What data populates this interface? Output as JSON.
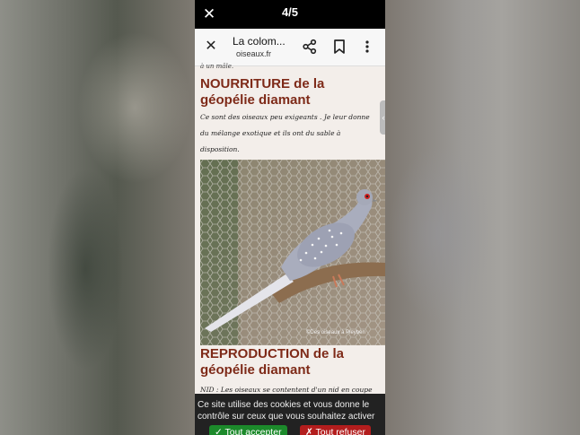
{
  "viewer": {
    "close_glyph": "✕",
    "counter": "4/5"
  },
  "browser": {
    "title": "La colom...",
    "domain": "oiseaux.fr",
    "close_glyph": "✕"
  },
  "article": {
    "prev_line": "à un mâle.",
    "heading1": [
      "NOURRITURE de la",
      "géopélie diamant"
    ],
    "text1": [
      "Ce sont des oiseaux peu exigeants . Je leur donne",
      "du mélange exotique et ils ont du sable à",
      "disposition."
    ],
    "photo_credit": "©Des oiseaux à Pleyben",
    "heading2": [
      "REPRODUCTION de la",
      "géopélie diamant"
    ],
    "text2": [
      "NID : Les oiseaux se contentent d'un nid en coupe"
    ]
  },
  "cookie": {
    "lines": [
      "Ce site utilise des cookies et vous donne le",
      "contrôle sur ceux que vous souhaitez activer"
    ],
    "accept_label": "✓ Tout accepter",
    "refuse_label": "✗ Tout refuser"
  },
  "colors": {
    "heading": "#7e2a18",
    "accept": "#1c8a2b",
    "refuse": "#b31d1d"
  },
  "icons": [
    "close-icon",
    "share-icon",
    "bookmark-icon",
    "more-vert-icon"
  ]
}
